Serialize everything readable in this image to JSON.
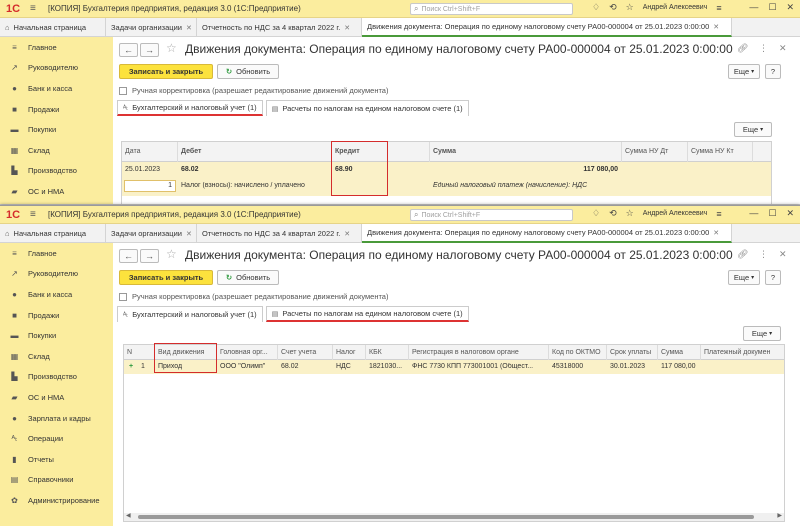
{
  "app": {
    "logo": "1С",
    "title_w1": "[КОПИЯ] Бухгалтерия предприятия, редакция 3.0  (1С:Предприятие)",
    "title_w2": "[КОПИЯ] Бухгалтерия предприятия, редакция 3.0  (1С:Предприятие)",
    "search_placeholder": "Поиск Ctrl+Shift+F",
    "user": "Андрей Алексеевич"
  },
  "tabs_w1": [
    {
      "label": "Начальная страница"
    },
    {
      "label": "Задачи организации"
    },
    {
      "label": "Отчетность по НДС за 4 квартал 2022 г."
    },
    {
      "label": "Движения документа: Операция по единому налоговому счету РА00-000004 от 25.01.2023 0:00:00"
    }
  ],
  "tabs_w2": [
    {
      "label": "Начальная страница"
    },
    {
      "label": "Задачи организации"
    },
    {
      "label": "Отчетность по НДС за 4 квартал 2022 г."
    },
    {
      "label": "Движения документа: Операция по единому налоговому счету РА00-000004 от 25.01.2023 0:00:00"
    }
  ],
  "sidebar_w1": [
    {
      "label": "Главное",
      "icon": "≡"
    },
    {
      "label": "Руководителю",
      "icon": "↗"
    },
    {
      "label": "Банк и касса",
      "icon": "●"
    },
    {
      "label": "Продажи",
      "icon": "■"
    },
    {
      "label": "Покупки",
      "icon": "▬"
    },
    {
      "label": "Склад",
      "icon": "▦"
    },
    {
      "label": "Производство",
      "icon": "▙"
    },
    {
      "label": "ОС и НМА",
      "icon": "▰"
    }
  ],
  "sidebar_w2": [
    {
      "label": "Главное",
      "icon": "≡"
    },
    {
      "label": "Руководителю",
      "icon": "↗"
    },
    {
      "label": "Банк и касса",
      "icon": "●"
    },
    {
      "label": "Продажи",
      "icon": "■"
    },
    {
      "label": "Покупки",
      "icon": "▬"
    },
    {
      "label": "Склад",
      "icon": "▦"
    },
    {
      "label": "Производство",
      "icon": "▙"
    },
    {
      "label": "ОС и НМА",
      "icon": "▰"
    },
    {
      "label": "Зарплата и кадры",
      "icon": "●"
    },
    {
      "label": "Операции",
      "icon": "ᴬₜ"
    },
    {
      "label": "Отчеты",
      "icon": "▮"
    },
    {
      "label": "Справочники",
      "icon": "▤"
    },
    {
      "label": "Администрирование",
      "icon": "✿"
    }
  ],
  "doc": {
    "title": "Движения документа: Операция по единому налоговому счету РА00-000004 от 25.01.2023 0:00:00",
    "save_close": "Записать и закрыть",
    "refresh": "Обновить",
    "more": "Еще",
    "help": "?",
    "manual_label": "Ручная корректировка (разрешает редактирование движений документа)"
  },
  "subtabs": {
    "accounting": "Бухгалтерский и налоговый учет (1)",
    "tax": "Расчеты по налогам на едином налоговом счете (1)"
  },
  "grid1": {
    "headers": {
      "date": "Дата",
      "debit": "Дебет",
      "credit": "Кредит",
      "sum": "Сумма",
      "sum_nu_dt": "Сумма НУ Дт",
      "sum_nu_kt": "Сумма НУ Кт"
    },
    "row": {
      "date": "25.01.2023",
      "num": "1",
      "debit": "68.02",
      "debit_sub": "Налог (взносы): начислено / уплачено",
      "credit": "68.90",
      "sum": "117 080,00",
      "content": "Единый налоговый платеж (начисление): НДС"
    }
  },
  "grid2": {
    "headers": {
      "n": "N",
      "kind": "Вид движения",
      "org": "Головная орг...",
      "account": "Счет учета",
      "tax": "Налог",
      "kbk": "КБК",
      "reg": "Регистрация в налоговом органе",
      "oktmo": "Код по ОКТМО",
      "due": "Срок уплаты",
      "sum": "Сумма",
      "paydoc": "Платежный докумен"
    },
    "row": {
      "plus": "+",
      "n": "1",
      "kind": "Приход",
      "org": "ООО \"Олимп\"",
      "account": "68.02",
      "tax": "НДС",
      "kbk": "1821030...",
      "reg": "ФНС 7730 КПП 773001001 (Общест...",
      "oktmo": "45318000",
      "due": "30.01.2023",
      "sum": "117 080,00"
    }
  }
}
